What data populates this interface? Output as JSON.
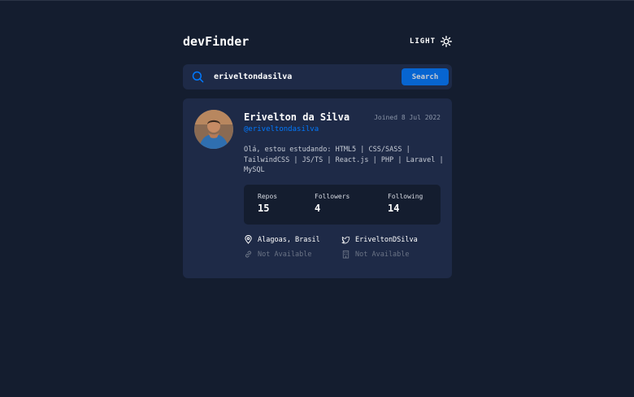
{
  "app": {
    "title": "devFinder",
    "theme_label": "LIGHT",
    "theme_icon": "sun-icon"
  },
  "search": {
    "value": "eriveltondasilva",
    "placeholder": "Search GitHub username…",
    "button_label": "Search",
    "icon": "search-icon"
  },
  "profile": {
    "name": "Erivelton da Silva",
    "joined": "Joined 8 Jul 2022",
    "login": "@eriveltondasilva",
    "bio": "Olá, estou estudando: HTML5 | CSS/SASS | TailwindCSS | JS/TS | React.js | PHP | Laravel | MySQL",
    "stats": {
      "repos_label": "Repos",
      "repos_value": "15",
      "followers_label": "Followers",
      "followers_value": "4",
      "following_label": "Following",
      "following_value": "14"
    },
    "links": {
      "location": "Alagoas, Brasil",
      "twitter": "EriveltonDSilva",
      "blog": "Not Available",
      "company": "Not Available"
    }
  },
  "colors": {
    "background": "#141d2f",
    "card": "#1e2a47",
    "accent": "#0079ff",
    "muted": "#6a7385"
  }
}
